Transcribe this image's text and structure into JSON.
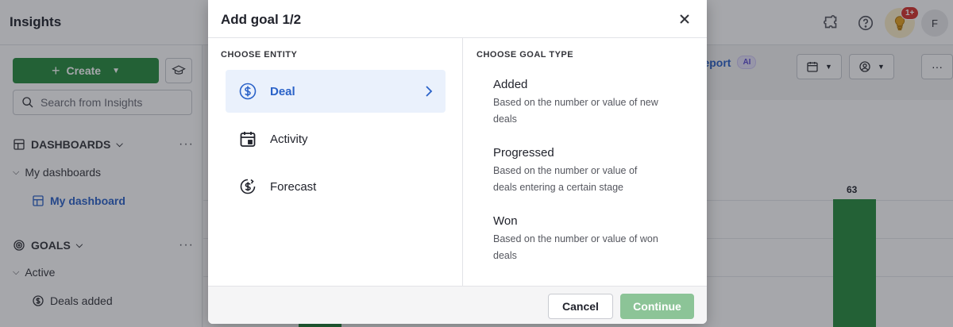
{
  "app": {
    "title": "Insights",
    "notification_count": "1+",
    "avatar_initial": "F"
  },
  "sidebar": {
    "create_label": "Create",
    "search_placeholder": "Search from Insights",
    "dashboards_header": "DASHBOARDS",
    "my_dashboards": "My dashboards",
    "my_dashboard": "My dashboard",
    "goals_header": "GOALS",
    "active": "Active",
    "deals_added": "Deals added"
  },
  "toolbar": {
    "report_label": "report",
    "ai_badge": "AI"
  },
  "chart": {
    "bar_value": "63"
  },
  "modal": {
    "title": "Add goal 1/2",
    "entity_section_label": "CHOOSE ENTITY",
    "goal_type_section_label": "CHOOSE GOAL TYPE",
    "entities": [
      {
        "label": "Deal",
        "icon": "dollar-circle-icon",
        "selected": true
      },
      {
        "label": "Activity",
        "icon": "calendar-icon",
        "selected": false
      },
      {
        "label": "Forecast",
        "icon": "forecast-icon",
        "selected": false
      }
    ],
    "goal_types": [
      {
        "title": "Added",
        "description": "Based on the number or value of new deals"
      },
      {
        "title": "Progressed",
        "description": "Based on the number or value of deals entering a certain stage"
      },
      {
        "title": "Won",
        "description": "Based on the number or value of won deals"
      }
    ],
    "cancel_label": "Cancel",
    "continue_label": "Continue"
  },
  "colors": {
    "accent_green": "#258a3d",
    "continue_disabled": "#8cc497",
    "selected_bg": "#eaf1fc",
    "selected_text": "#2a62c8"
  }
}
